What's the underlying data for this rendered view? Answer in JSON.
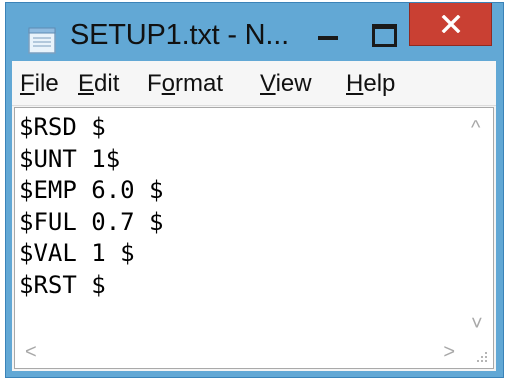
{
  "window": {
    "title": "SETUP1.txt - N..."
  },
  "icons": {
    "app": "notepad-icon",
    "minimize": "minimize-icon",
    "maximize": "maximize-icon",
    "close": "close-icon",
    "scroll_up": "scroll-up-arrow-icon",
    "scroll_down": "scroll-down-arrow-icon",
    "scroll_left": "scroll-left-arrow-icon",
    "scroll_right": "scroll-right-arrow-icon",
    "grip": "resize-grip-icon"
  },
  "menu": {
    "file": {
      "accel": "F",
      "rest": "ile"
    },
    "edit": {
      "accel": "E",
      "rest": "dit"
    },
    "format": {
      "pre": "F",
      "accel": "o",
      "rest": "rmat"
    },
    "view": {
      "accel": "V",
      "rest": "iew"
    },
    "help": {
      "accel": "H",
      "rest": "elp"
    }
  },
  "editor": {
    "lines": [
      "$RSD $",
      "$UNT 1$",
      "$EMP 6.0 $",
      "$FUL 0.7 $",
      "$VAL 1 $",
      "$RST $"
    ]
  },
  "scroll_glyphs": {
    "up": "^",
    "down": "˅",
    "left": "<",
    "right": ">"
  },
  "colors": {
    "titlebar": "#62a8d5",
    "close_button": "#c94033"
  }
}
